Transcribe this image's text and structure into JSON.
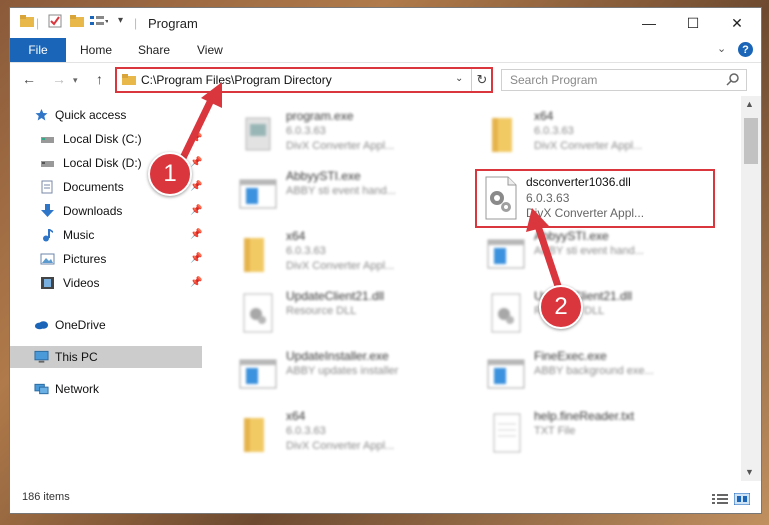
{
  "window": {
    "title": "Program",
    "controls": {
      "minimize": "—",
      "maximize": "☐",
      "close": "✕"
    }
  },
  "ribbon": {
    "tabs": [
      {
        "label": "File",
        "active": true
      },
      {
        "label": "Home"
      },
      {
        "label": "Share"
      },
      {
        "label": "View"
      }
    ],
    "help": "?"
  },
  "nav": {
    "back": "←",
    "forward": "→",
    "up": "↑",
    "address": "C:\\Program Files\\Program Directory",
    "search_placeholder": "Search Program"
  },
  "sidebar": {
    "items": [
      {
        "label": "Quick access",
        "icon": "star-icon"
      },
      {
        "label": "Local Disk (C:)",
        "icon": "drive-icon",
        "pinned": true
      },
      {
        "label": "Local Disk (D:)",
        "icon": "drive-icon",
        "pinned": true
      },
      {
        "label": "Documents",
        "icon": "documents-icon",
        "pinned": true
      },
      {
        "label": "Downloads",
        "icon": "downloads-icon",
        "pinned": true
      },
      {
        "label": "Music",
        "icon": "music-icon",
        "pinned": true
      },
      {
        "label": "Pictures",
        "icon": "pictures-icon",
        "pinned": true
      },
      {
        "label": "Videos",
        "icon": "videos-icon",
        "pinned": true
      },
      {
        "label": "OneDrive",
        "icon": "onedrive-icon"
      },
      {
        "label": "This PC",
        "icon": "this-pc-icon",
        "selected": true
      },
      {
        "label": "Network",
        "icon": "network-icon"
      }
    ]
  },
  "files": {
    "left": [
      {
        "name": "program.exe",
        "ver": "6.0.3.63",
        "desc": "DivX Converter Appl...",
        "icon": "app-icon"
      },
      {
        "name": "AbbyySTI.exe",
        "ver": "ABBY sti event hand...",
        "desc": "",
        "icon": "exe-window-icon"
      },
      {
        "name": "x64",
        "ver": "6.0.3.63",
        "desc": "DivX Converter Appl...",
        "icon": "folder-icon"
      },
      {
        "name": "UpdateClient21.dll",
        "ver": "Resource DLL",
        "desc": "",
        "icon": "dll-icon"
      },
      {
        "name": "UpdateInstaller.exe",
        "ver": "ABBY updates installer",
        "desc": "",
        "icon": "exe-window-icon"
      },
      {
        "name": "x64",
        "ver": "6.0.3.63",
        "desc": "DivX Converter Appl...",
        "icon": "folder-icon"
      }
    ],
    "right": [
      {
        "name": "x64",
        "ver": "6.0.3.63",
        "desc": "DivX Converter Appl...",
        "icon": "folder-icon"
      },
      {
        "name": "AbbyySTI.exe",
        "ver": "ABBY sti event hand...",
        "desc": "",
        "icon": "exe-window-icon"
      },
      {
        "name": "UpdateClient21.dll",
        "ver": "Resource DLL",
        "desc": "",
        "icon": "dll-icon"
      },
      {
        "name": "FineExec.exe",
        "ver": "ABBY background exe...",
        "desc": "",
        "icon": "exe-window-icon"
      },
      {
        "name": "help.fineReader.txt",
        "ver": "TXT File",
        "desc": "",
        "icon": "txt-icon"
      }
    ],
    "highlighted": {
      "name": "dsconverter1036.dll",
      "ver": "6.0.3.63",
      "desc": "DivX Converter Appl..."
    }
  },
  "status": {
    "count": "186 items"
  },
  "callouts": {
    "one": "1",
    "two": "2"
  },
  "colors": {
    "accent": "#1a65b8",
    "highlight": "#d9363e"
  }
}
